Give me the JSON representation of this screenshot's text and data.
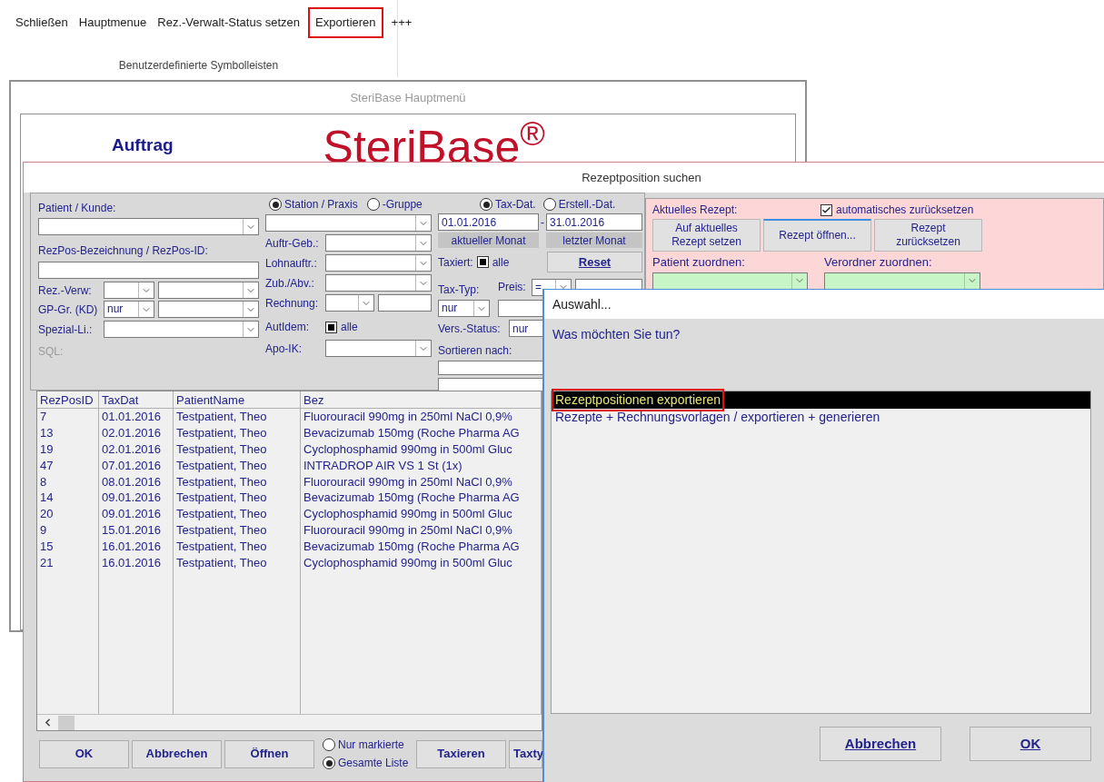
{
  "toolbar": {
    "items": [
      {
        "label": "Schließen",
        "highlighted": false
      },
      {
        "label": "Hauptmenue",
        "highlighted": false
      },
      {
        "label": "Rez.-Verwalt-Status setzen",
        "highlighted": false
      },
      {
        "label": "Exportieren",
        "highlighted": true
      },
      {
        "label": "+++",
        "highlighted": false
      }
    ],
    "group_label": "Benutzerdefinierte Symbolleisten"
  },
  "main_window": {
    "title": "SteriBase Hauptmenü",
    "section": "Auftrag",
    "logo": "SteriBase$^{®}$"
  },
  "search_window": {
    "title": "Rezeptposition suchen",
    "filters": {
      "patient_label": "Patient / Kunde:",
      "rezpos_label": "RezPos-Bezeichnung / RezPos-ID:",
      "rez_verw_label": "Rez.-Verw:",
      "gp_gr_label": "GP-Gr. (KD)",
      "gp_gr_value": "nur",
      "spezial_label": "Spezial-Li.:",
      "sql_label": "SQL:",
      "scope_options": [
        {
          "label": "Station / Praxis",
          "selected": true
        },
        {
          "label": "-Gruppe",
          "selected": false
        }
      ],
      "auftr_geb_label": "Auftr-Geb.:",
      "lohnauftr_label": "Lohnauftr.:",
      "zub_label": "Zub./Abv.:",
      "rechnung_label": "Rechnung:",
      "autidem": {
        "label": "AutIdem:",
        "indeterminate": true,
        "text": "alle"
      },
      "apo_ik_label": "Apo-IK:",
      "date_options": [
        {
          "label": "Tax-Dat.",
          "selected": true
        },
        {
          "label": "Erstell.-Dat.",
          "selected": false
        }
      ],
      "date_from": "01.01.2016",
      "date_sep": "-",
      "date_to": "31.01.2016",
      "current_month_button": "aktueller Monat",
      "last_month_button": "letzter Monat",
      "taxiert": {
        "label": "Taxiert:",
        "indeterminate": true,
        "text": "alle"
      },
      "reset_button": "Reset",
      "tax_typ_label": "Tax-Typ:",
      "tax_typ_value": "nur",
      "preis_label": "Preis:",
      "preis_op": "=",
      "vers_status_label": "Vers.-Status:",
      "vers_status_value": "nur",
      "sort_label": "Sortieren nach:"
    },
    "current_recipe": {
      "label": "Aktuelles Rezept:",
      "auto_reset": {
        "label": "automatisches zurücksetzen",
        "checked": true
      },
      "buttons": [
        {
          "lines": [
            "Auf aktuelles",
            "Rezept setzen"
          ],
          "focused": false
        },
        {
          "lines": [
            "Rezept öffnen..."
          ],
          "focused": true
        },
        {
          "lines": [
            "Rezept",
            "zurücksetzen"
          ],
          "focused": false
        }
      ],
      "patient_label": "Patient zuordnen:",
      "prescriber_label": "Verordner zuordnen:"
    },
    "table": {
      "columns": [
        "RezPosID",
        "TaxDat",
        "PatientName",
        "Bez"
      ],
      "rows": [
        [
          "7",
          "01.01.2016",
          "Testpatient, Theo",
          "Fluorouracil 990mg in 250ml NaCl 0,9%"
        ],
        [
          "13",
          "02.01.2016",
          "Testpatient, Theo",
          "Bevacizumab 150mg (Roche Pharma AG"
        ],
        [
          "19",
          "02.01.2016",
          "Testpatient, Theo",
          "Cyclophosphamid 990mg in 500ml Gluc"
        ],
        [
          "47",
          "07.01.2016",
          "Testpatient, Theo",
          "INTRADROP AIR VS   1 St (1x)"
        ],
        [
          "8",
          "08.01.2016",
          "Testpatient, Theo",
          "Fluorouracil 990mg in 250ml NaCl 0,9%"
        ],
        [
          "14",
          "09.01.2016",
          "Testpatient, Theo",
          "Bevacizumab 150mg (Roche Pharma AG"
        ],
        [
          "20",
          "09.01.2016",
          "Testpatient, Theo",
          "Cyclophosphamid 990mg in 500ml Gluc"
        ],
        [
          "9",
          "15.01.2016",
          "Testpatient, Theo",
          "Fluorouracil 990mg in 250ml NaCl 0,9%"
        ],
        [
          "15",
          "16.01.2016",
          "Testpatient, Theo",
          "Bevacizumab 150mg (Roche Pharma AG"
        ],
        [
          "21",
          "16.01.2016",
          "Testpatient, Theo",
          "Cyclophosphamid 990mg in 500ml Gluc"
        ]
      ]
    },
    "buttons_left": [
      "OK",
      "Abbrechen",
      "Öffnen"
    ],
    "list_scope": [
      {
        "label": "Nur markierte",
        "selected": false
      },
      {
        "label": "Gesamte Liste",
        "selected": true
      }
    ],
    "buttons_right": [
      "Taxieren",
      "Taxty"
    ]
  },
  "dialog": {
    "title": "Auswahl...",
    "question": "Was möchten Sie tun?",
    "items": [
      {
        "label": "Rezeptpositionen exportieren",
        "selected": true,
        "highlighted": true
      },
      {
        "label": "Rezepte + Rechnungsvorlagen / exportieren + generieren",
        "selected": false,
        "highlighted": false
      }
    ],
    "buttons": [
      "Abbrechen",
      "OK"
    ]
  }
}
